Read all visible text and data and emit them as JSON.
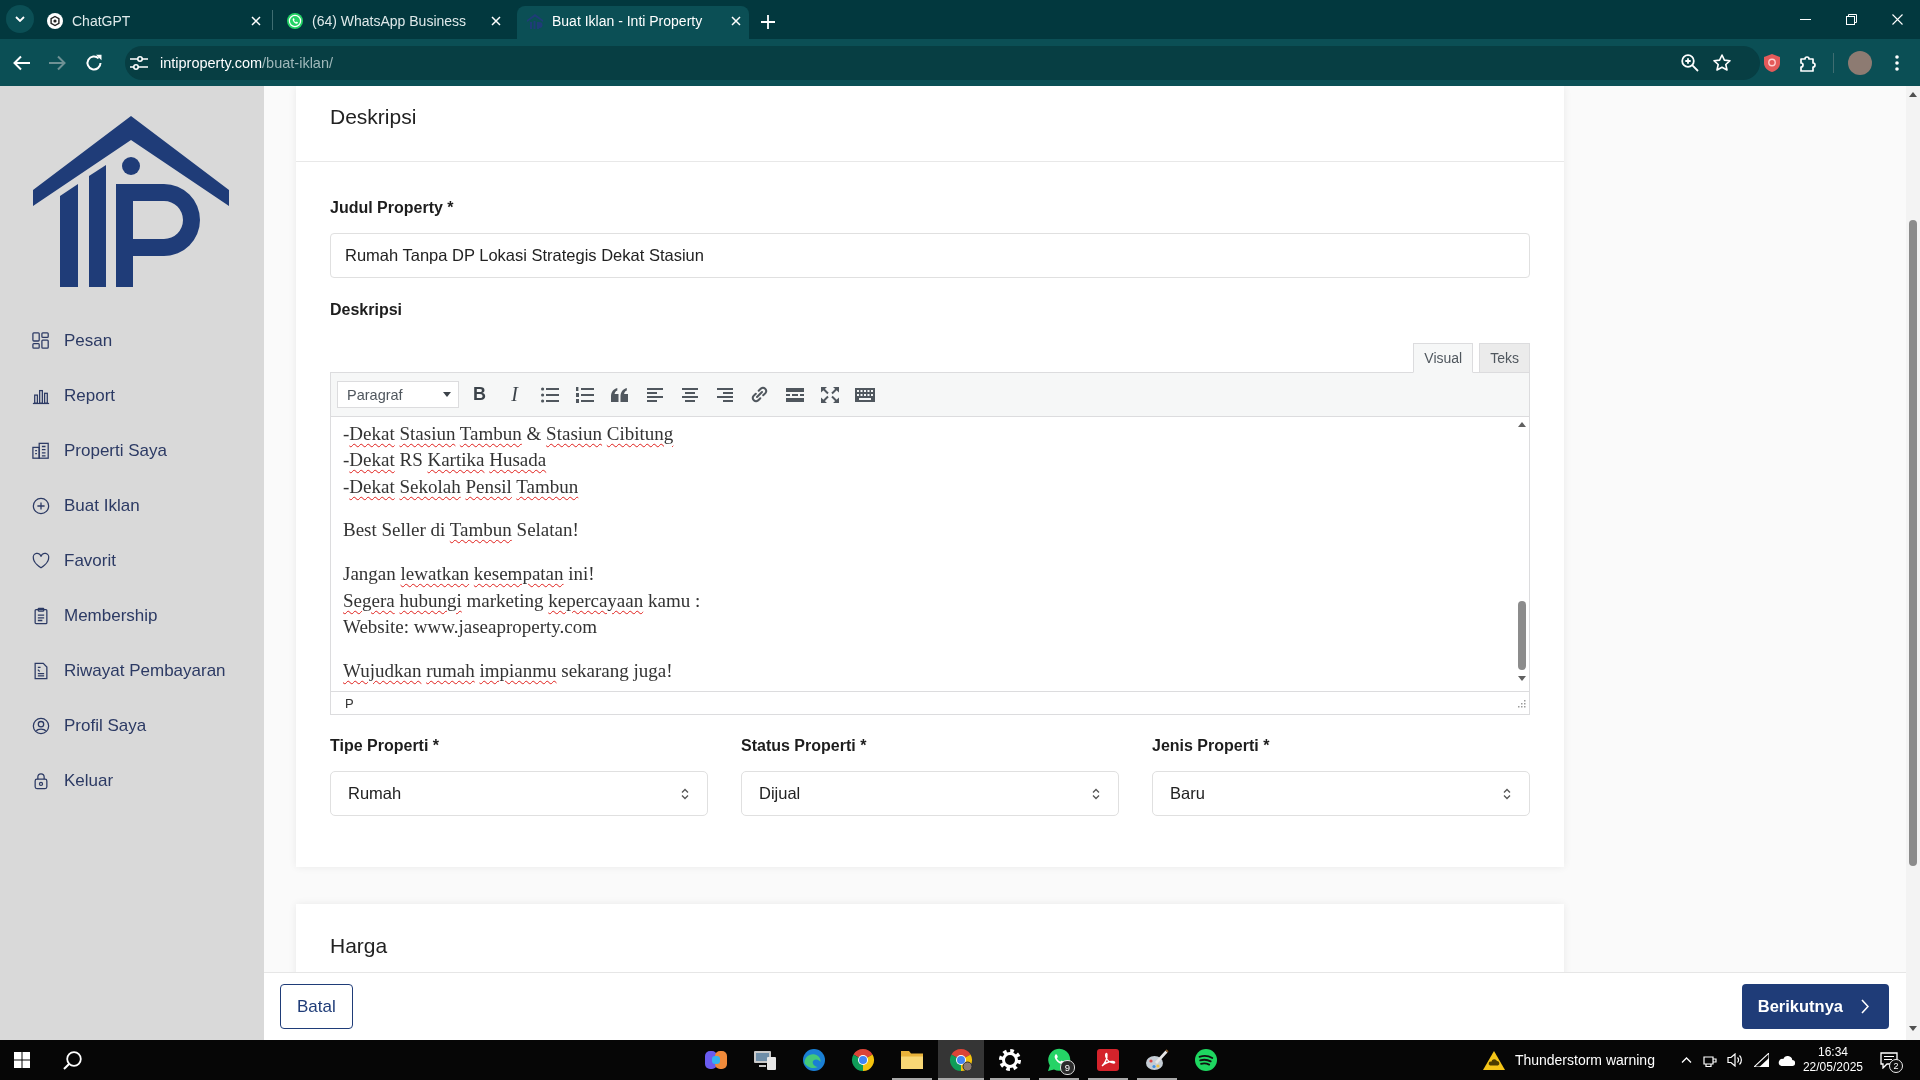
{
  "browser": {
    "tabs": [
      {
        "title": "ChatGPT",
        "selected": false
      },
      {
        "title": "(64) WhatsApp Business",
        "selected": false
      },
      {
        "title": "Buat Iklan - Inti Property",
        "selected": true
      }
    ],
    "navigation": {
      "back_disabled": false,
      "forward_disabled": true
    },
    "address": {
      "host": "intiproperty.com",
      "path": "/buat-iklan/"
    }
  },
  "sidebar": {
    "items": [
      {
        "label": "Pesan"
      },
      {
        "label": "Report"
      },
      {
        "label": "Properti Saya"
      },
      {
        "label": "Buat Iklan"
      },
      {
        "label": "Favorit"
      },
      {
        "label": "Membership"
      },
      {
        "label": "Riwayat Pembayaran"
      },
      {
        "label": "Profil Saya"
      },
      {
        "label": "Keluar"
      }
    ]
  },
  "form": {
    "section_title": "Deskripsi",
    "title_field": {
      "label": "Judul Property *",
      "value": "Rumah Tanpa DP Lokasi Strategis Dekat Stasiun"
    },
    "description": {
      "label": "Deskripsi",
      "modes": [
        {
          "label": "Visual",
          "selected": true
        },
        {
          "label": "Teks",
          "selected": false
        }
      ],
      "toolbar": {
        "format": "Paragraf",
        "bold": "B",
        "italic": "I"
      },
      "paragraphs": [
        {
          "lines": [
            [
              {
                "text": "-",
                "misspelled": false
              },
              {
                "text": "Dekat ",
                "misspelled": true
              },
              {
                "text": "Stasiun ",
                "misspelled": true
              },
              {
                "text": "Tambun",
                "misspelled": true
              },
              {
                "text": " & ",
                "misspelled": false
              },
              {
                "text": "Stasiun ",
                "misspelled": true
              },
              {
                "text": "Cibitung",
                "misspelled": true
              }
            ],
            [
              {
                "text": "-",
                "misspelled": false
              },
              {
                "text": "Dekat",
                "misspelled": true
              },
              {
                "text": " RS ",
                "misspelled": false
              },
              {
                "text": "Kartika ",
                "misspelled": true
              },
              {
                "text": "Husada",
                "misspelled": true
              }
            ],
            [
              {
                "text": "-",
                "misspelled": false
              },
              {
                "text": "Dekat ",
                "misspelled": true
              },
              {
                "text": "Sekolah ",
                "misspelled": true
              },
              {
                "text": "Pensil ",
                "misspelled": true
              },
              {
                "text": "Tambun",
                "misspelled": true
              }
            ]
          ]
        },
        {
          "lines": [
            [
              {
                "text": "Best Seller di ",
                "misspelled": false
              },
              {
                "text": "Tambun",
                "misspelled": true
              },
              {
                "text": " Selatan!",
                "misspelled": false
              }
            ]
          ]
        },
        {
          "lines": [
            [
              {
                "text": "Jangan ",
                "misspelled": false
              },
              {
                "text": "lewatkan ",
                "misspelled": true
              },
              {
                "text": "kesempatan",
                "misspelled": true
              },
              {
                "text": " ini!",
                "misspelled": false
              }
            ],
            [
              {
                "text": "Segera ",
                "misspelled": true
              },
              {
                "text": "hubungi",
                "misspelled": true
              },
              {
                "text": " marketing ",
                "misspelled": false
              },
              {
                "text": "kepercayaan",
                "misspelled": true
              },
              {
                "text": " kamu :",
                "misspelled": false
              }
            ],
            [
              {
                "text": "Website: www.jaseaproperty.com",
                "misspelled": false
              }
            ]
          ]
        },
        {
          "lines": [
            [
              {
                "text": "Wujudkan ",
                "misspelled": true
              },
              {
                "text": "rumah ",
                "misspelled": true
              },
              {
                "text": "impianmu",
                "misspelled": true
              },
              {
                "text": " sekarang juga!",
                "misspelled": false
              }
            ]
          ]
        }
      ],
      "element_path": "P"
    },
    "selects": [
      {
        "label": "Tipe Properti *",
        "value": "Rumah"
      },
      {
        "label": "Status Properti *",
        "value": "Dijual"
      },
      {
        "label": "Jenis Properti *",
        "value": "Baru"
      }
    ],
    "next_section_title": "Harga"
  },
  "actions": {
    "cancel": "Batal",
    "next": "Berikutnya"
  },
  "taskbar": {
    "apps": [
      {
        "running": false,
        "selected": false
      },
      {
        "running": false,
        "selected": false
      },
      {
        "running": false,
        "selected": false
      },
      {
        "running": false,
        "selected": false
      },
      {
        "running": true,
        "selected": false
      },
      {
        "running": true,
        "selected": true
      },
      {
        "running": true,
        "selected": false
      },
      {
        "running": true,
        "selected": false,
        "badge": "9"
      },
      {
        "running": true,
        "selected": false
      },
      {
        "running": true,
        "selected": false
      },
      {
        "running": false,
        "selected": false
      }
    ],
    "weather": "Thunderstorm warning",
    "time": "16:34",
    "date": "22/05/2025",
    "notifications": "2"
  }
}
